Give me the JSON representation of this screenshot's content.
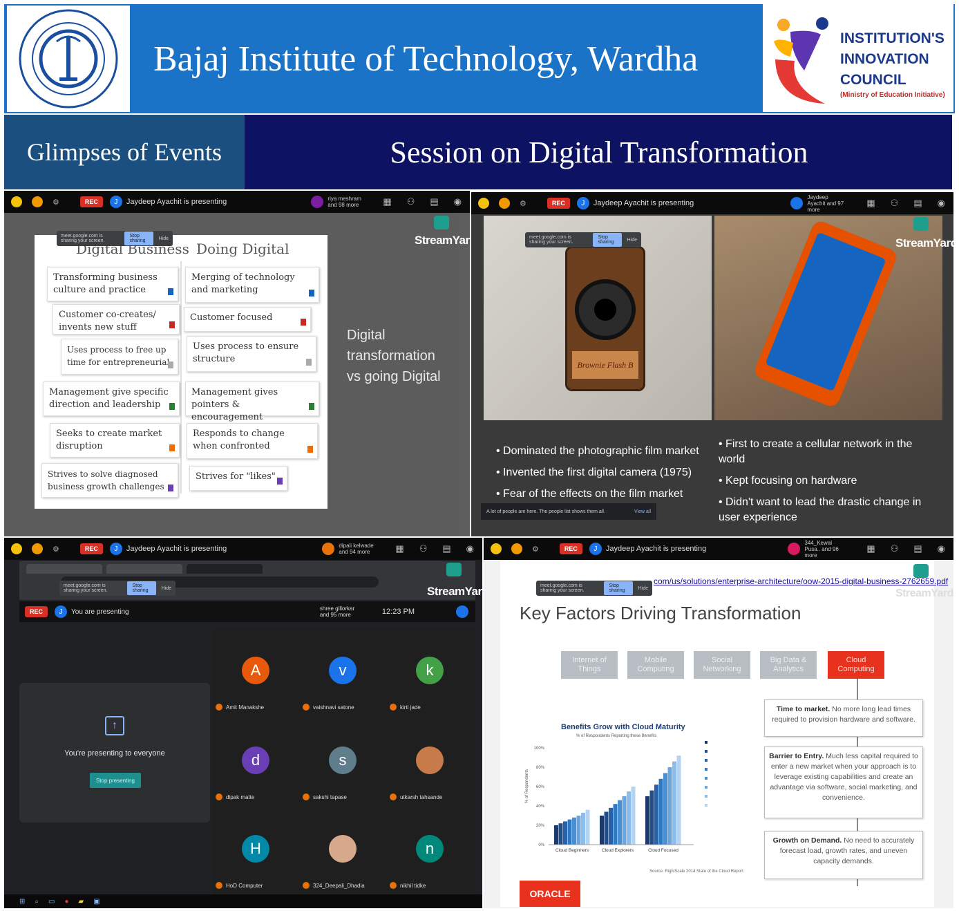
{
  "header": {
    "institute_title": "Bajaj Institute of Technology, Wardha",
    "iic_line1": "INSTITUTION'S",
    "iic_line2": "INNOVATION",
    "iic_line3": "COUNCIL",
    "iic_sub": "(Ministry of Education Initiative)",
    "left_tag": "Glimpses of Events",
    "session_title": "Session on Digital Transformation"
  },
  "colors": {
    "banner_blue": "#1a73c6",
    "strip_navy": "#0e1262",
    "tag_blue": "#1b4f7f",
    "rec_red": "#d93025"
  },
  "streamyard": "StreamYard",
  "panel1": {
    "rec": "REC",
    "presenting": "Jaydeep Ayachit is presenting",
    "more": "riya meshram and 98 more",
    "col1_title": "Digital Business",
    "col2_title": "Doing Digital",
    "col1": [
      "Transforming business culture and practice",
      "Customer co-creates/ invents new stuff",
      "Uses process to free up time for entrepreneurial",
      "Management give specific direction and leadership",
      "Seeks to create market disruption",
      "Strives to solve diagnosed business growth challenges"
    ],
    "col2": [
      "Merging of technology and marketing",
      "Customer focused",
      "Uses process to ensure structure",
      "Management gives pointers & encouragement",
      "Responds to change when confronted",
      "Strives for \"likes\""
    ],
    "side_text": "Digital transformation vs going Digital"
  },
  "panel2": {
    "rec": "REC",
    "presenting": "Jaydeep Ayachit is presenting",
    "more": "Jaydeep Ayachit and 97 more",
    "camera_label": "Brownie Flash B",
    "left_bullets": [
      "Dominated the photographic film market",
      "Invented the first digital camera (1975)",
      "Fear of the effects on the film market"
    ],
    "right_bullets": [
      "First to create a cellular network in the world",
      "Kept focusing on hardware",
      "Didn't want to lead the drastic change in user experience"
    ],
    "toast": "A lot of people are here. The people list shows them all.",
    "toast_action": "View all"
  },
  "panel3": {
    "rec": "REC",
    "presenting": "Jaydeep Ayachit is presenting",
    "more": "dipali kelwade and 94 more",
    "inner_rec": "REC",
    "inner_presenting": "You are presenting",
    "inner_more": "shree gillorkar and 95 more",
    "time": "12:23 PM",
    "presenting_msg": "You're presenting to everyone",
    "stop_btn": "Stop presenting",
    "participants": [
      {
        "initial": "A",
        "name": "Amit Manakshe",
        "color": "#e8590c"
      },
      {
        "initial": "v",
        "name": "vaishnavi satone",
        "color": "#1a73e8"
      },
      {
        "initial": "k",
        "name": "kirti jade",
        "color": "#43a047"
      },
      {
        "initial": "d",
        "name": "dipak matte",
        "color": "#6a3fb5"
      },
      {
        "initial": "s",
        "name": "sakshi tapase",
        "color": "#607d8b"
      },
      {
        "initial": "",
        "name": "utkarsh tahsande",
        "color": "#c77b4a"
      },
      {
        "initial": "H",
        "name": "HoD Computer",
        "color": "#0288a8"
      },
      {
        "initial": "",
        "name": "324_Deepali_Dhadia",
        "color": "#d7a98c"
      },
      {
        "initial": "n",
        "name": "nikhil tidke",
        "color": "#00897b"
      }
    ]
  },
  "panel4": {
    "rec": "REC",
    "presenting": "Jaydeep Ayachit is presenting",
    "more": "344_Kewal Pusa.. and 96 more",
    "url": "com/us/solutions/enterprise-architecture/oow-2015-digital-business-2762659.pdf",
    "title": "Key Factors Driving Transformation",
    "techs": [
      "Internet of Things",
      "Mobile Computing",
      "Social Networking",
      "Big Data & Analytics",
      "Cloud Computing"
    ],
    "chart_title": "Benefits Grow with Cloud Maturity",
    "chart_subtitle": "% of Respondents Reporting these Benefits",
    "chart_ylabel": "% of Respondents",
    "chart_source": "Source: RightScale 2014 State of the Cloud Report",
    "benefits": [
      {
        "head": "Time to market.",
        "body": "No more long lead times required to provision hardware and software."
      },
      {
        "head": "Barrier to Entry.",
        "body": "Much less capital required to enter a new market when your approach is to leverage existing capabilities and create an advantage via software, social marketing, and convenience."
      },
      {
        "head": "Growth on Demand.",
        "body": "No need to accurately forecast load, growth rates, and uneven capacity demands."
      }
    ],
    "brand": "ORACLE"
  },
  "chart_data": {
    "type": "bar",
    "title": "Benefits Grow with Cloud Maturity",
    "subtitle": "% of Respondents Reporting these Benefits",
    "ylabel": "% of Respondents",
    "xlabel": "",
    "categories": [
      "Cloud Beginners",
      "Cloud Explorers",
      "Cloud Focused"
    ],
    "yticks": [
      "0%",
      "20%",
      "40%",
      "60%",
      "80%",
      "100%"
    ],
    "ylim": [
      0,
      100
    ],
    "series": [
      {
        "values": [
          20,
          30,
          50
        ]
      },
      {
        "values": [
          22,
          34,
          56
        ]
      },
      {
        "values": [
          24,
          38,
          62
        ]
      },
      {
        "values": [
          26,
          42,
          68
        ]
      },
      {
        "values": [
          28,
          46,
          74
        ]
      },
      {
        "values": [
          30,
          50,
          80
        ]
      },
      {
        "values": [
          33,
          55,
          86
        ]
      },
      {
        "values": [
          36,
          60,
          92
        ]
      }
    ],
    "legend_position": "right",
    "source": "Source: RightScale 2014 State of the Cloud Report"
  }
}
